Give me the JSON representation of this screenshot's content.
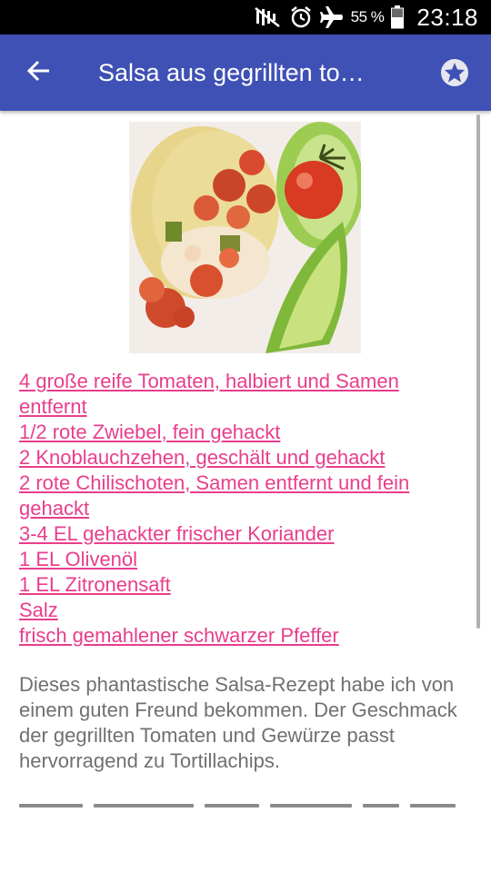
{
  "status_bar": {
    "battery_percent": "55 %",
    "time": "23:18",
    "icons": [
      "mute-icon",
      "alarm-icon",
      "airplane-mode-icon",
      "battery-icon"
    ]
  },
  "app_bar": {
    "title": "Salsa aus gegrillten to…",
    "back_icon": "arrow-back-icon",
    "favorite_icon": "star-icon"
  },
  "recipe": {
    "image_alt": "salsa-photo",
    "ingredients": [
      "4 große reife Tomaten, halbiert und Samen entfernt",
      "1/2 rote Zwiebel, fein gehackt",
      "2 Knoblauchzehen, geschält und gehackt",
      "2 rote Chilischoten, Samen entfernt und fein gehackt",
      "3-4 EL gehackter frischer Koriander",
      "1 EL Olivenöl",
      "1 EL Zitronensaft",
      "Salz",
      "frisch gemahlener schwarzer Pfeffer"
    ],
    "description": "Dieses phantastische Salsa-Rezept habe ich von einem guten Freund bekommen. Der Geschmack der gegrillten Tomaten und Gewürze passt hervorragend zu Tortillachips."
  },
  "colors": {
    "app_bar": "#3f51b5",
    "ingredient_link": "#e83e8c",
    "body_text": "#707070"
  }
}
